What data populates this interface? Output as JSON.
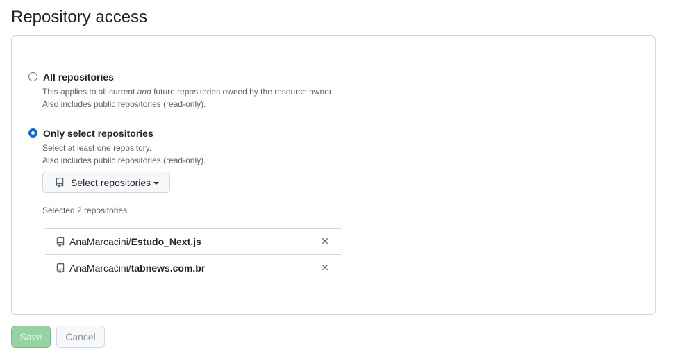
{
  "page": {
    "title": "Repository access"
  },
  "options": {
    "all": {
      "label": "All repositories",
      "desc_before": "This applies to all current ",
      "desc_em": "and",
      "desc_after": " future repositories owned by the resource owner.",
      "desc_line2": "Also includes public repositories (read-only).",
      "checked": false
    },
    "select": {
      "label": "Only select repositories",
      "desc_line1": "Select at least one repository.",
      "desc_line2": "Also includes public repositories (read-only).",
      "checked": true
    }
  },
  "select_button": {
    "label": "Select repositories",
    "icon": "repo-icon"
  },
  "selected_count_text": "Selected 2 repositories.",
  "repositories": [
    {
      "owner": "AnaMarcacini/",
      "name": "Estudo_Next.js"
    },
    {
      "owner": "AnaMarcacini/",
      "name": "tabnews.com.br"
    }
  ],
  "footer": {
    "save_label": "Save",
    "cancel_label": "Cancel"
  },
  "colors": {
    "accent": "#0969da",
    "save_disabled_bg": "#94d3a2",
    "border": "#d0d7de"
  }
}
